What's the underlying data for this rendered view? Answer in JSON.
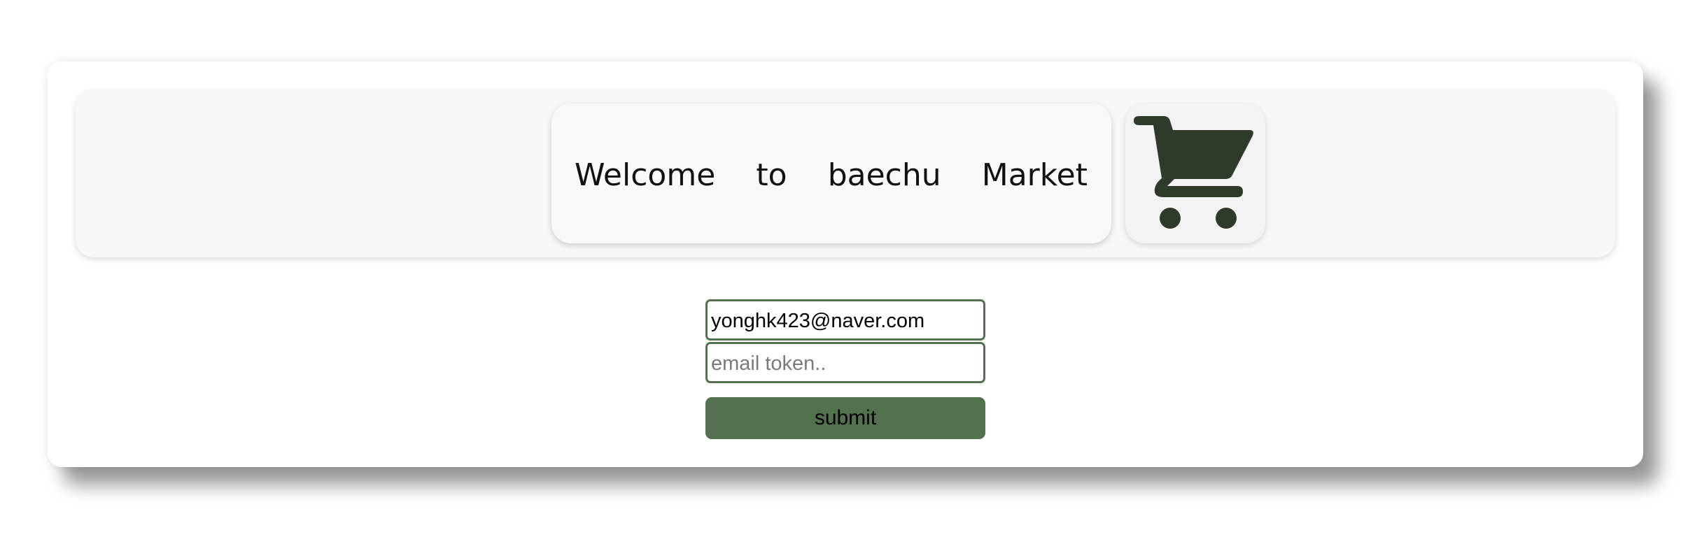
{
  "header": {
    "welcome_words": [
      "Welcome",
      "to",
      "baechu",
      "Market"
    ]
  },
  "cart": {
    "icon": "shopping-cart-icon",
    "color": "#2e3b2b"
  },
  "form": {
    "email_value": "yonghk423@naver.com",
    "token_placeholder": "email token..",
    "token_value": "",
    "submit_label": "submit"
  },
  "colors": {
    "accent": "#53704f",
    "panel_bg": "#f8f8f8"
  }
}
